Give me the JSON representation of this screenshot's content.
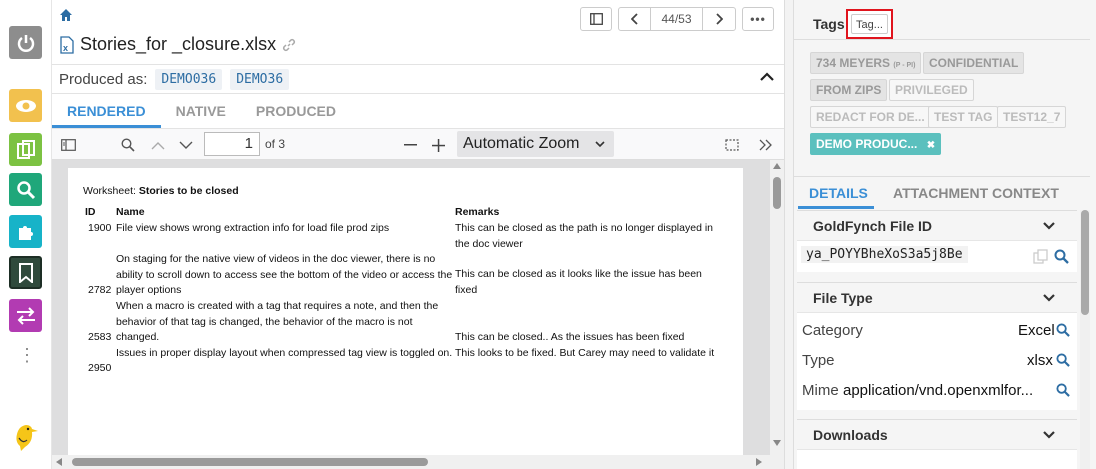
{
  "doc": {
    "title": "Stories_for _closure.xlsx",
    "produced_label": "Produced as:",
    "produced_ids": [
      "DEMO036",
      "DEMO36"
    ],
    "page_counter": "44/53"
  },
  "tabs": [
    "RENDERED",
    "NATIVE",
    "PRODUCED"
  ],
  "pdf": {
    "page": "1",
    "of": "of 3",
    "zoom": "Automatic Zoom"
  },
  "sheet": {
    "worksheet_label": "Worksheet:",
    "worksheet_name": "Stories to be closed",
    "headers": {
      "id": "ID",
      "name": "Name",
      "remarks": "Remarks"
    },
    "rows": [
      {
        "id": "1900",
        "name": "File view shows wrong extraction info for load file prod zips",
        "remarks": "This can be closed as the path is no longer displayed in the doc viewer"
      },
      {
        "id": "2782",
        "name": "On staging for the native view of videos in the doc viewer, there is no ability to scroll down to access see the bottom of the video or access the player options",
        "remarks": "This can be closed as it looks like the issue has been fixed"
      },
      {
        "id": "2583",
        "name": "When a macro is created with a tag that requires a note, and then the behavior of that tag is changed, the behavior of the macro is not changed.",
        "remarks": "This can be closed.. As the issues has been fixed"
      },
      {
        "id": "2950",
        "name": "Issues in proper display layout when compressed tag view is toggled on.",
        "remarks": "This looks to be fixed. But Carey may need to validate it"
      }
    ]
  },
  "tags": {
    "title": "Tags",
    "add_label": "Tag...",
    "items": [
      {
        "label": "734 MEYERS",
        "sub": "(P - PI)"
      },
      {
        "label": "CONFIDENTIAL"
      },
      {
        "label": "FROM ZIPS"
      },
      {
        "label": "PRIVILEGED"
      },
      {
        "label": "REDACT FOR DE..."
      },
      {
        "label": "TEST TAG"
      },
      {
        "label": "TEST12_7"
      },
      {
        "label": "DEMO PRODUC..."
      }
    ],
    "remove_icon": "✖"
  },
  "details": {
    "tabs": [
      "DETAILS",
      "ATTACHMENT CONTEXT"
    ],
    "goldfynch": {
      "title": "GoldFynch File ID",
      "value": "ya_POYYBheXoS3a5j8Be"
    },
    "filetype": {
      "title": "File Type",
      "category_label": "Category",
      "category": "Excel",
      "type_label": "Type",
      "type": "xlsx",
      "mime_label": "Mime",
      "mime": "application/vnd.openxmlfor..."
    },
    "downloads": {
      "title": "Downloads"
    }
  },
  "colors": {
    "accent": "#3b8fd6",
    "tag_active": "#5bc0be",
    "highlight": "#e0141d"
  }
}
